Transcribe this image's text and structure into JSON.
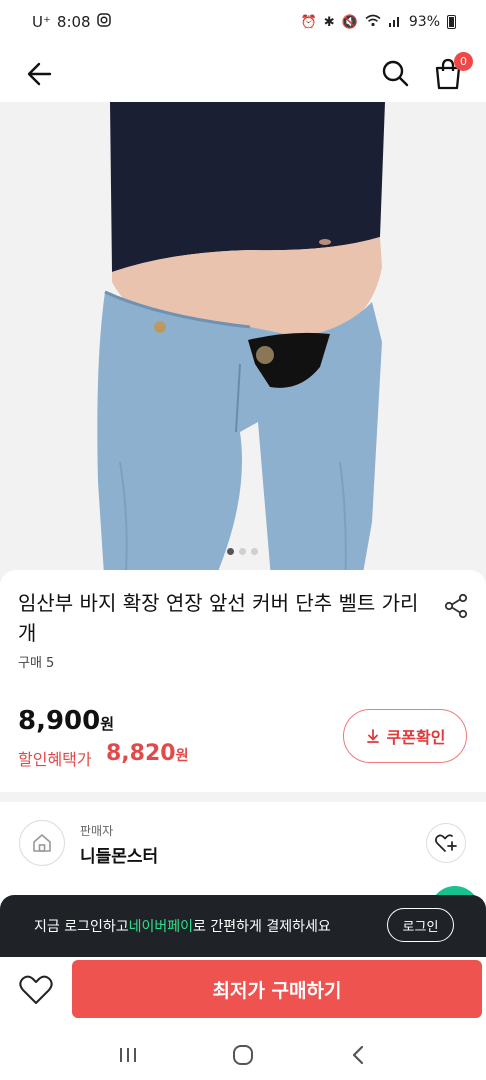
{
  "status_bar": {
    "carrier": "U⁺",
    "time": "8:08",
    "battery": "93%"
  },
  "header": {
    "back_icon": "arrow-left-icon",
    "search_icon": "search-icon",
    "cart_icon": "shopping-bag-icon",
    "cart_count": "0"
  },
  "gallery": {
    "pages": 3,
    "active_page": 1
  },
  "product": {
    "title": "임산부 바지 확장 연장 앞선 커버 단추 벨트 가리개",
    "sales": "구매 5",
    "price": "8,900",
    "price_unit": "원",
    "discount_label": "할인혜택가",
    "discount_price": "8,820",
    "discount_unit": "원",
    "coupon_label": "쿠폰확인"
  },
  "seller": {
    "caption": "판매자",
    "name": "니들몬스터"
  },
  "banner": {
    "text_before": "지금 로그인하고 ",
    "highlight": "네이버페이",
    "text_after": "로 간편하게 결제하세요",
    "login_label": "로그인"
  },
  "bottom": {
    "buy_label": "최저가 구매하기"
  },
  "colors": {
    "accent_red": "#ef5350",
    "discount_red": "#e24a4a",
    "naver_green": "#2fe08a",
    "banner_bg": "#1f2328"
  }
}
